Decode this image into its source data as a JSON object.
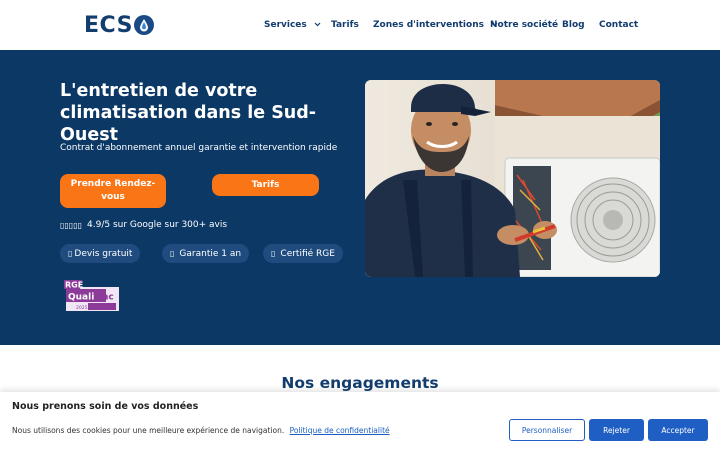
{
  "logo": {
    "text": "ECS"
  },
  "nav": {
    "items": [
      {
        "label": "Services"
      },
      {
        "label": "Tarifs"
      },
      {
        "label": "Zones d'interventions"
      },
      {
        "label": "Notre société"
      },
      {
        "label": "Blog"
      },
      {
        "label": "Contact"
      }
    ]
  },
  "hero": {
    "title": "L'entretien de votre climatisation dans le Sud-Ouest",
    "subtitle": "Contrat d'abonnement annuel garantie et intervention rapide",
    "cta_primary": "Prendre Rendez-vous",
    "cta_secondary": "Tarifs",
    "rating_stars": "▯▯▯▯▯",
    "rating_text": "4.9/5 sur Google sur 300+ avis",
    "badges": [
      {
        "icon": "▯",
        "label": "Devis gratuit"
      },
      {
        "icon": "▯",
        "label": "Garantie 1 an"
      },
      {
        "icon": "▯",
        "label": "Certifié RGE"
      }
    ],
    "certification": {
      "rge": "RGE",
      "name_part1": "Quali",
      "name_part2": "Pac",
      "year": "2025"
    }
  },
  "engagements": {
    "title": "Nos engagements"
  },
  "cookie": {
    "title": "Nous prenons soin de vos données",
    "text": "Nous utilisons des cookies pour une meilleure expérience de navigation.",
    "link": "Politique de confidentialité",
    "btn_customize": "Personnaliser",
    "btn_reject": "Rejeter",
    "btn_accept": "Accepter"
  },
  "colors": {
    "brand_navy": "#0c3866",
    "accent_orange": "#f97516",
    "cookie_blue": "#1f5fc4"
  }
}
